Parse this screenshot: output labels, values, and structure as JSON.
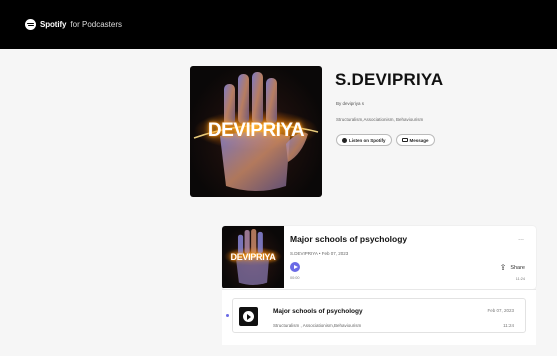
{
  "brand": {
    "name": "Spotify",
    "sub": "for Podcasters"
  },
  "show": {
    "cover_text": "DEVIPRIYA",
    "title": "S.DEVIPRIYA",
    "author": "By devipriya s",
    "categories": "Structuralism,Associationism, Behaviourism",
    "listen_label": "Listen on Spotify",
    "message_label": "Message"
  },
  "episode_card": {
    "cover_text": "DEVIPRIYA",
    "title": "Major schools of psychology",
    "meta": "S.DEVIPRIYA • Feb 07, 2023",
    "length": "00:00",
    "more": "...",
    "share_label": "Share",
    "duration": "11:24"
  },
  "episode_row": {
    "title": "Major schools of psychology",
    "subtitle": "Structuralism , Associationism,Behaviourism",
    "date": "Feb 07, 2023",
    "duration": "11:24"
  },
  "colors": {
    "accent": "#6a6ae6",
    "topbar": "#000000",
    "background": "#f6f6f6"
  }
}
